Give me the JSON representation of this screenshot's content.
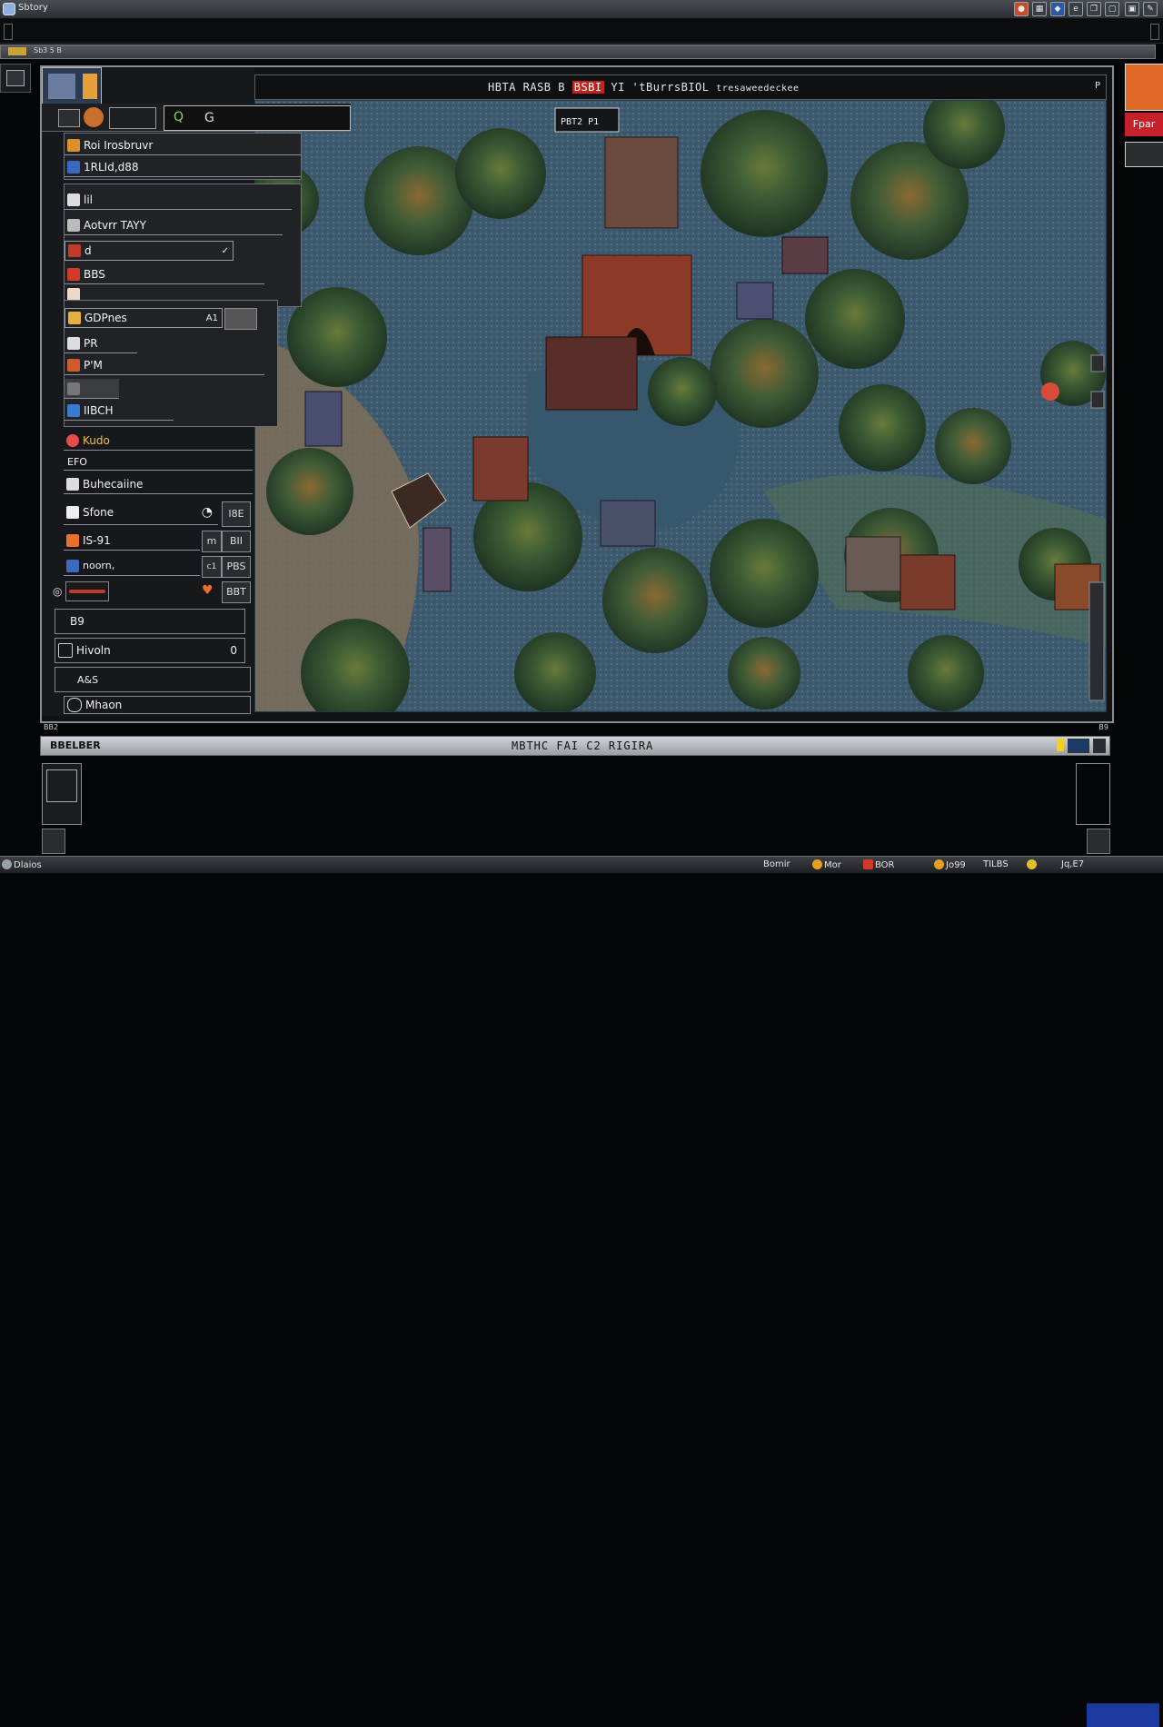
{
  "window": {
    "title": "Sbtory"
  },
  "strip": {
    "label": "Sb3 5 B"
  },
  "header": {
    "title_a": "HBTA RASB B",
    "title_red": "BSBI",
    "title_b": "YI 'tBurrsBIOL",
    "title_c": "tresaweedeckee",
    "corner": "P"
  },
  "map_labels": {
    "sign": "PBT2 P1",
    "pixel_colors": {
      "water": "#3d5a6e",
      "grass": "#4a6a4a",
      "dirt": "#8a7a5e",
      "tree": "#2f4a2a",
      "roof": "#9a3a28"
    }
  },
  "toolbar": {
    "tab_icon": "Q",
    "tab_label": "G"
  },
  "panel": {
    "dropdown1": [
      {
        "label": "Roi Irosbruvr",
        "icon": "orange-icon"
      },
      {
        "label": "1RLId,d88",
        "icon": "blue-icon"
      }
    ],
    "dropdown2": [
      {
        "label": "lil",
        "icon": "tool-icon"
      },
      {
        "label": "Aotvrr TAYY",
        "icon": "glyph-icon"
      },
      {
        "label": "d",
        "icon": "brush-icon",
        "suffix": "✓"
      },
      {
        "label": "BBS",
        "icon": "red-icon"
      },
      {
        "label": "",
        "icon": "pig-icon"
      }
    ],
    "dropdown3": [
      {
        "label": "GDPnes",
        "icon": "sun-icon",
        "badge": "A1"
      },
      {
        "label": "PR",
        "icon": "bar-icon"
      },
      {
        "label": "P'M",
        "icon": "flame-icon"
      },
      {
        "label": "",
        "icon": "gray-icon"
      },
      {
        "label": "IIBCH",
        "icon": "monitor-icon"
      }
    ],
    "list": [
      {
        "label": "Kudo",
        "icon": "heart-icon"
      },
      {
        "label": "EFO",
        "icon": ""
      },
      {
        "label": "Buhecaiine",
        "icon": "doc-icon"
      },
      {
        "label": "Sfone",
        "icon": "page-icon",
        "extra": "I8E"
      },
      {
        "label": "IS-91",
        "icon": "orange-sq-icon",
        "extra": "BII"
      },
      {
        "label": "noorn,",
        "icon": "blue-sq-icon",
        "extra": "PBS"
      },
      {
        "label": "",
        "icon": "red-bar-icon",
        "extra": "BBT"
      },
      {
        "label": "B9",
        "icon": "",
        "extra": ""
      },
      {
        "label": "Hivoln",
        "icon": "bracket-icon",
        "extra": "0"
      },
      {
        "label": "A&S",
        "icon": "",
        "extra": ""
      },
      {
        "label": "Mhaon",
        "icon": "circle-icon",
        "extra": ""
      }
    ]
  },
  "status": {
    "left": "BB2",
    "right": "B9"
  },
  "console": {
    "left": "BBELBER",
    "middle": "MBTHC FAI  C2 RIGIRA"
  },
  "taskbar": {
    "start": "Dlaios",
    "items": [
      "Bomir",
      "Mor",
      "BOR",
      "Jo99",
      "TILBS",
      "Jq,E7"
    ]
  },
  "right": {
    "badge": "Fpar"
  }
}
